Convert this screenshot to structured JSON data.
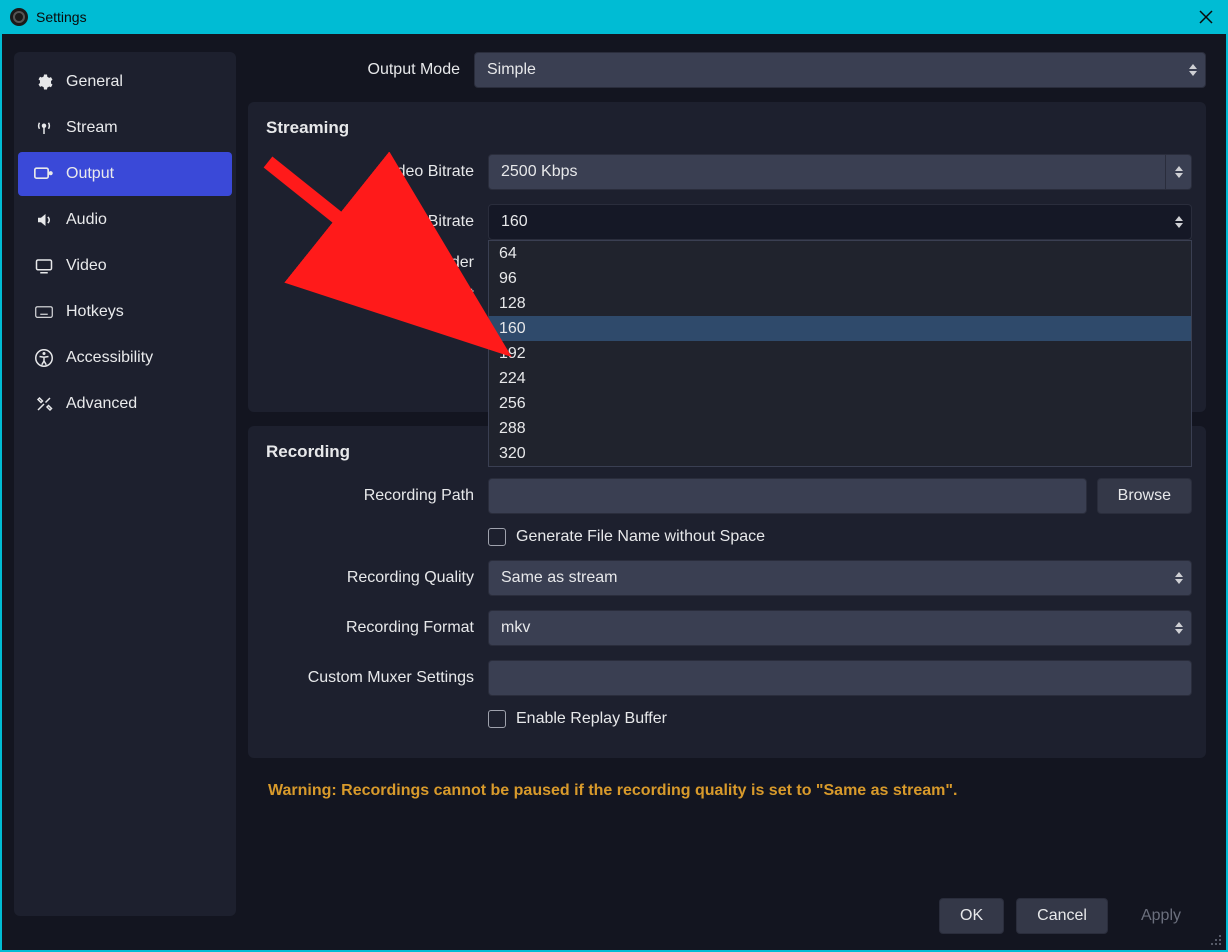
{
  "window": {
    "title": "Settings"
  },
  "sidebar": {
    "items": [
      {
        "label": "General"
      },
      {
        "label": "Stream"
      },
      {
        "label": "Output"
      },
      {
        "label": "Audio"
      },
      {
        "label": "Video"
      },
      {
        "label": "Hotkeys"
      },
      {
        "label": "Accessibility"
      },
      {
        "label": "Advanced"
      }
    ],
    "active_index": 2
  },
  "output_mode": {
    "label": "Output Mode",
    "value": "Simple"
  },
  "streaming": {
    "title": "Streaming",
    "video_bitrate": {
      "label": "Video Bitrate",
      "value": "2500 Kbps"
    },
    "audio_bitrate": {
      "label": "Audio Bitrate",
      "value": "160",
      "options": [
        "64",
        "96",
        "128",
        "160",
        "192",
        "224",
        "256",
        "288",
        "320"
      ]
    },
    "encoder": {
      "label": "Encoder"
    },
    "encoder_preset": {
      "label": "Encoder Preset"
    }
  },
  "recording": {
    "title": "Recording",
    "path": {
      "label": "Recording Path",
      "value": "",
      "browse": "Browse"
    },
    "gen_no_space": {
      "label": "Generate File Name without Space",
      "checked": false
    },
    "quality": {
      "label": "Recording Quality",
      "value": "Same as stream"
    },
    "format": {
      "label": "Recording Format",
      "value": "mkv"
    },
    "muxer": {
      "label": "Custom Muxer Settings",
      "value": ""
    },
    "replay_buffer": {
      "label": "Enable Replay Buffer",
      "checked": false
    }
  },
  "warning": "Warning: Recordings cannot be paused if the recording quality is set to \"Same as stream\".",
  "footer": {
    "ok": "OK",
    "cancel": "Cancel",
    "apply": "Apply"
  }
}
